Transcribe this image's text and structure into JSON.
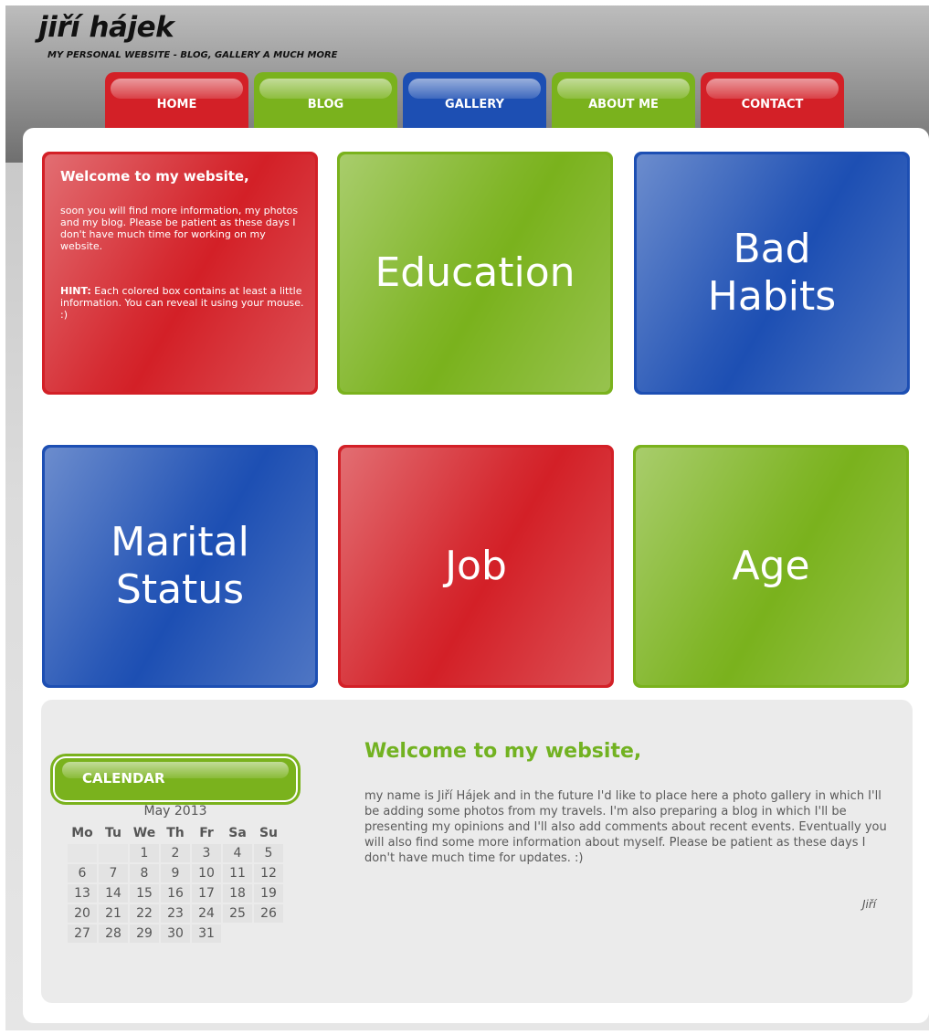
{
  "header": {
    "title": "jiří hájek",
    "subtitle": "MY PERSONAL WEBSITE - BLOG, GALLERY A MUCH MORE"
  },
  "nav": {
    "items": [
      {
        "label": "HOME",
        "color": "#d32027"
      },
      {
        "label": "BLOG",
        "color": "#7ab21d"
      },
      {
        "label": "GALLERY",
        "color": "#1d4fb3"
      },
      {
        "label": "ABOUT ME",
        "color": "#7ab21d"
      },
      {
        "label": "CONTACT",
        "color": "#d32027"
      }
    ]
  },
  "tiles": {
    "welcome": {
      "heading": "Welcome to my website,",
      "text": "soon you will find more information, my photos and my blog. Please be patient as these days I don't have much time for working on my website.",
      "hint_label": "HINT:",
      "hint_text": " Each colored box contains at least a little information. You can reveal it using your mouse. :)"
    },
    "education": "Education",
    "bad_habits": "Bad\nHabits",
    "marital_status": "Marital\nStatus",
    "job": "Job",
    "age": "Age"
  },
  "calendar": {
    "title": "CALENDAR",
    "month": "May 2013",
    "weekdays": [
      "Mo",
      "Tu",
      "We",
      "Th",
      "Fr",
      "Sa",
      "Su"
    ],
    "weeks": [
      [
        "",
        "",
        "1",
        "2",
        "3",
        "4",
        "5"
      ],
      [
        "6",
        "7",
        "8",
        "9",
        "10",
        "11",
        "12"
      ],
      [
        "13",
        "14",
        "15",
        "16",
        "17",
        "18",
        "19"
      ],
      [
        "20",
        "21",
        "22",
        "23",
        "24",
        "25",
        "26"
      ],
      [
        "27",
        "28",
        "29",
        "30",
        "31"
      ]
    ]
  },
  "main": {
    "title": "Welcome to my website,",
    "text": "my name is Jiří Hájek and in the future I'd like to place here a photo gallery in which I'll be adding some photos from my travels. I'm also preparing a blog in which I'll be presenting my opinions and I'll also add comments about recent events. Eventually you will also find some more information about myself. Please be patient as these days I don't have much time for updates. :)",
    "signature": "Jiří"
  },
  "colors": {
    "red": "#d32027",
    "green": "#7ab21d",
    "blue": "#1d4fb3"
  }
}
